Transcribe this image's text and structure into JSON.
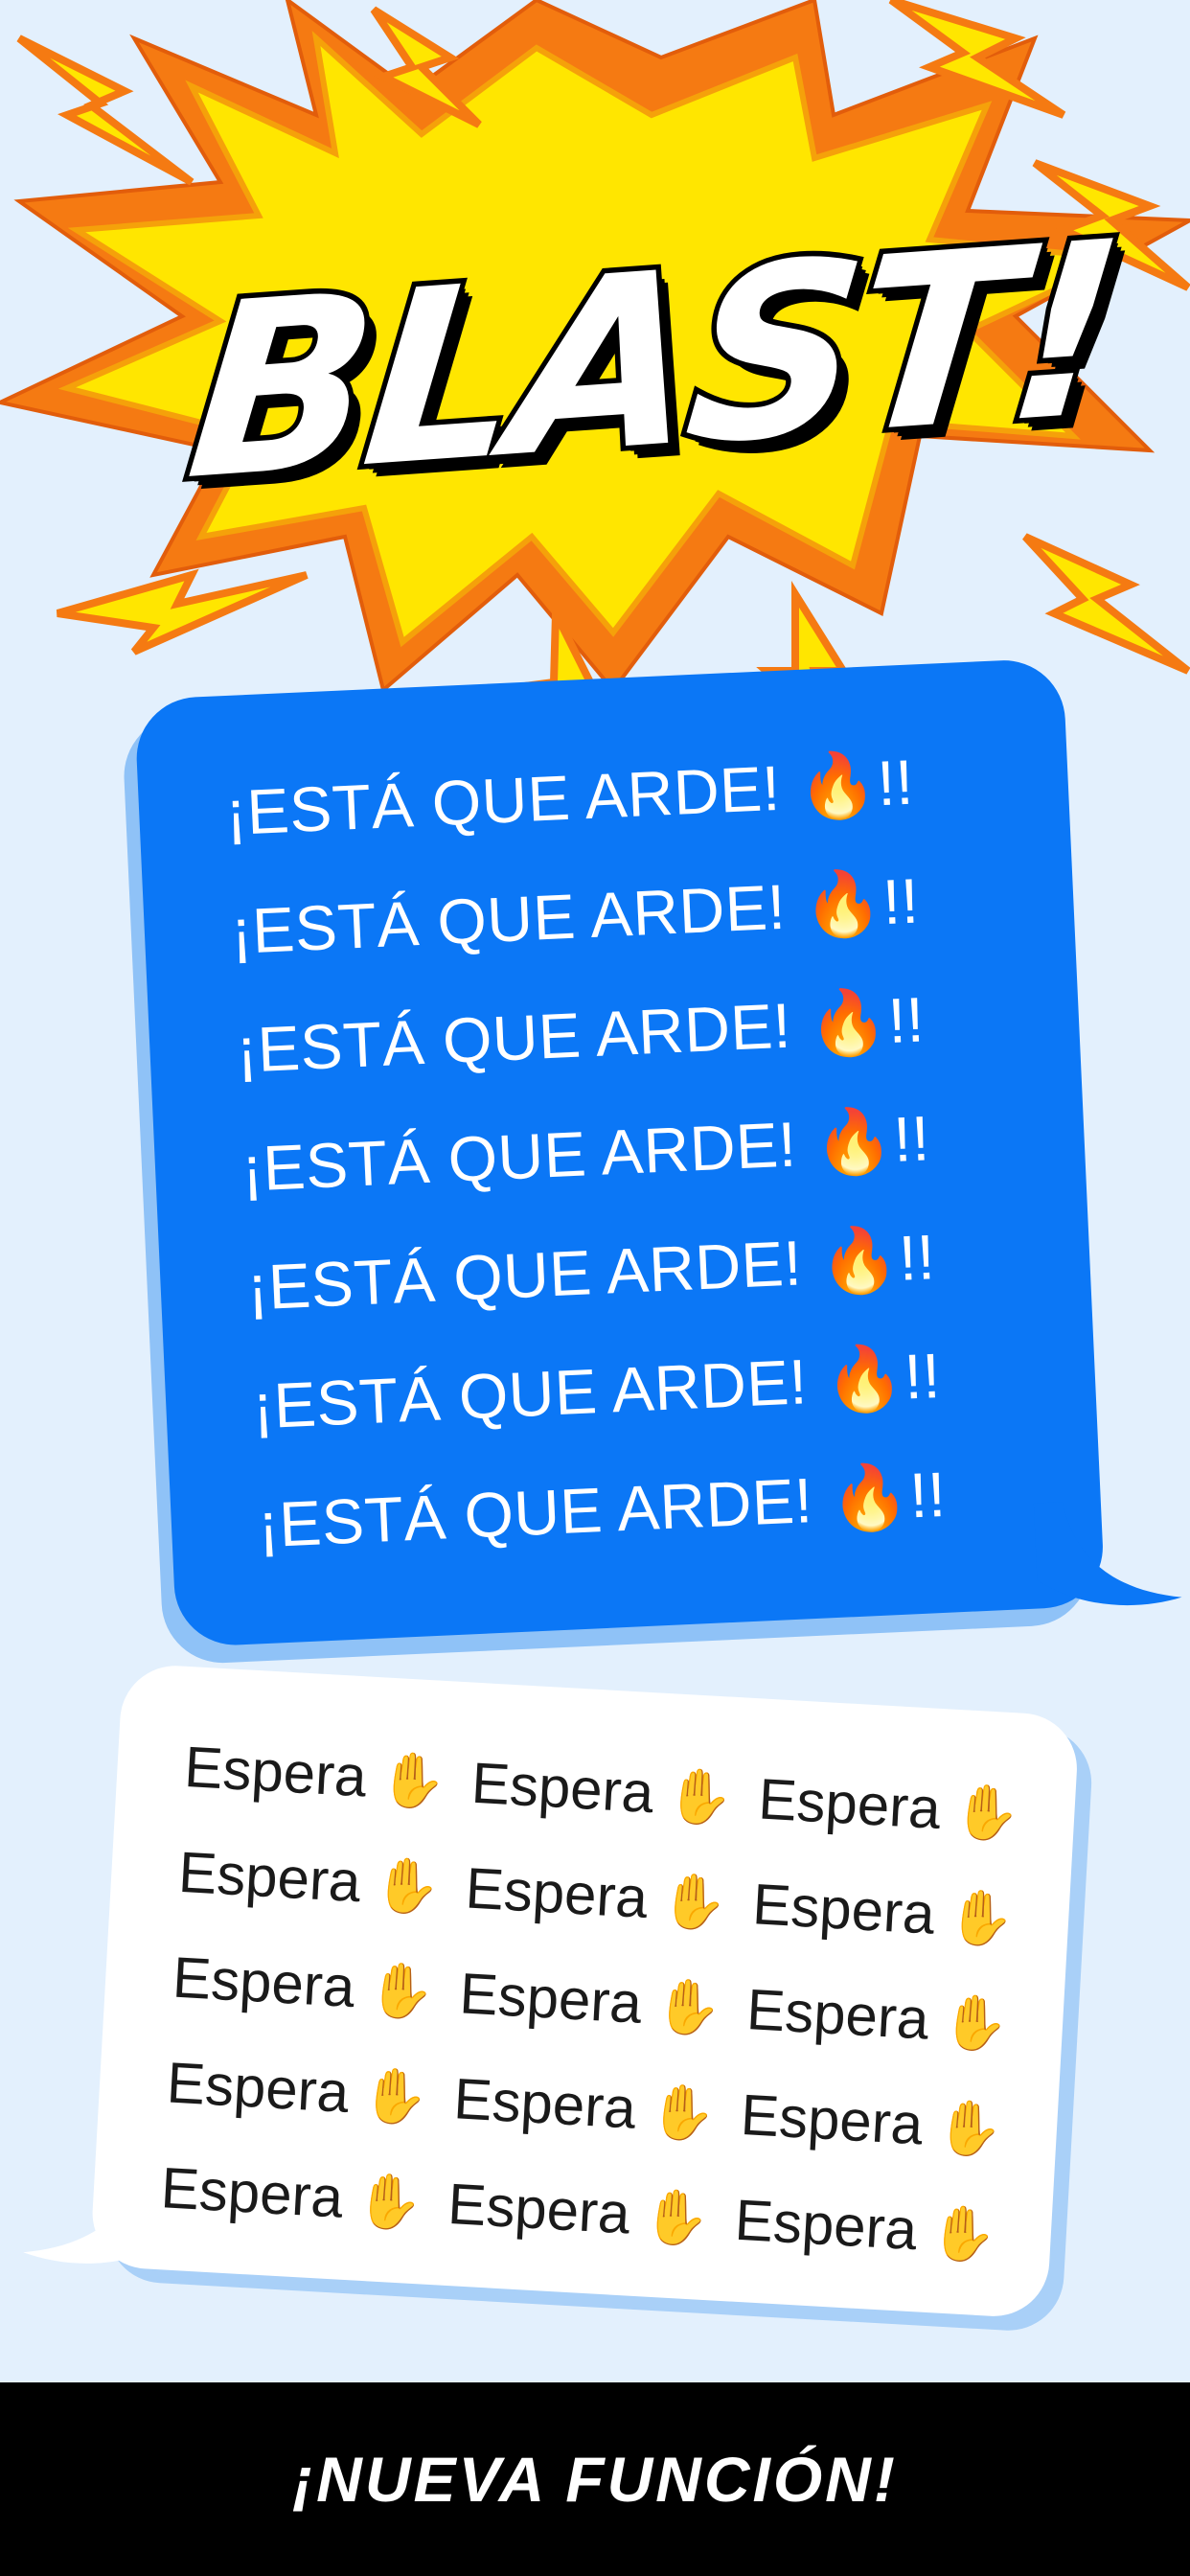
{
  "headline": {
    "text": "BLAST!"
  },
  "blue_bubble": {
    "lines": [
      "¡ESTÁ QUE ARDE! 🔥!!",
      "¡ESTÁ QUE ARDE! 🔥!!",
      "¡ESTÁ QUE ARDE! 🔥!!",
      "¡ESTÁ QUE ARDE! 🔥!!",
      "¡ESTÁ QUE ARDE! 🔥!!",
      "¡ESTÁ QUE ARDE! 🔥!!",
      "¡ESTÁ QUE ARDE! 🔥!!"
    ]
  },
  "white_bubble": {
    "word": "Espera",
    "emoji": "✋",
    "rows": 5,
    "columns": 3
  },
  "footer": {
    "text": "¡NUEVA FUNCIÓN!"
  },
  "colors": {
    "background": "#e3f0fd",
    "blue_bubble": "#0b77f6",
    "burst_yellow": "#ffe600",
    "burst_orange": "#f57a12",
    "footer_bg": "#000000"
  },
  "icons": [
    "starburst-icon",
    "lightning-bolt-icon",
    "fire-emoji",
    "raised-hand-emoji"
  ]
}
